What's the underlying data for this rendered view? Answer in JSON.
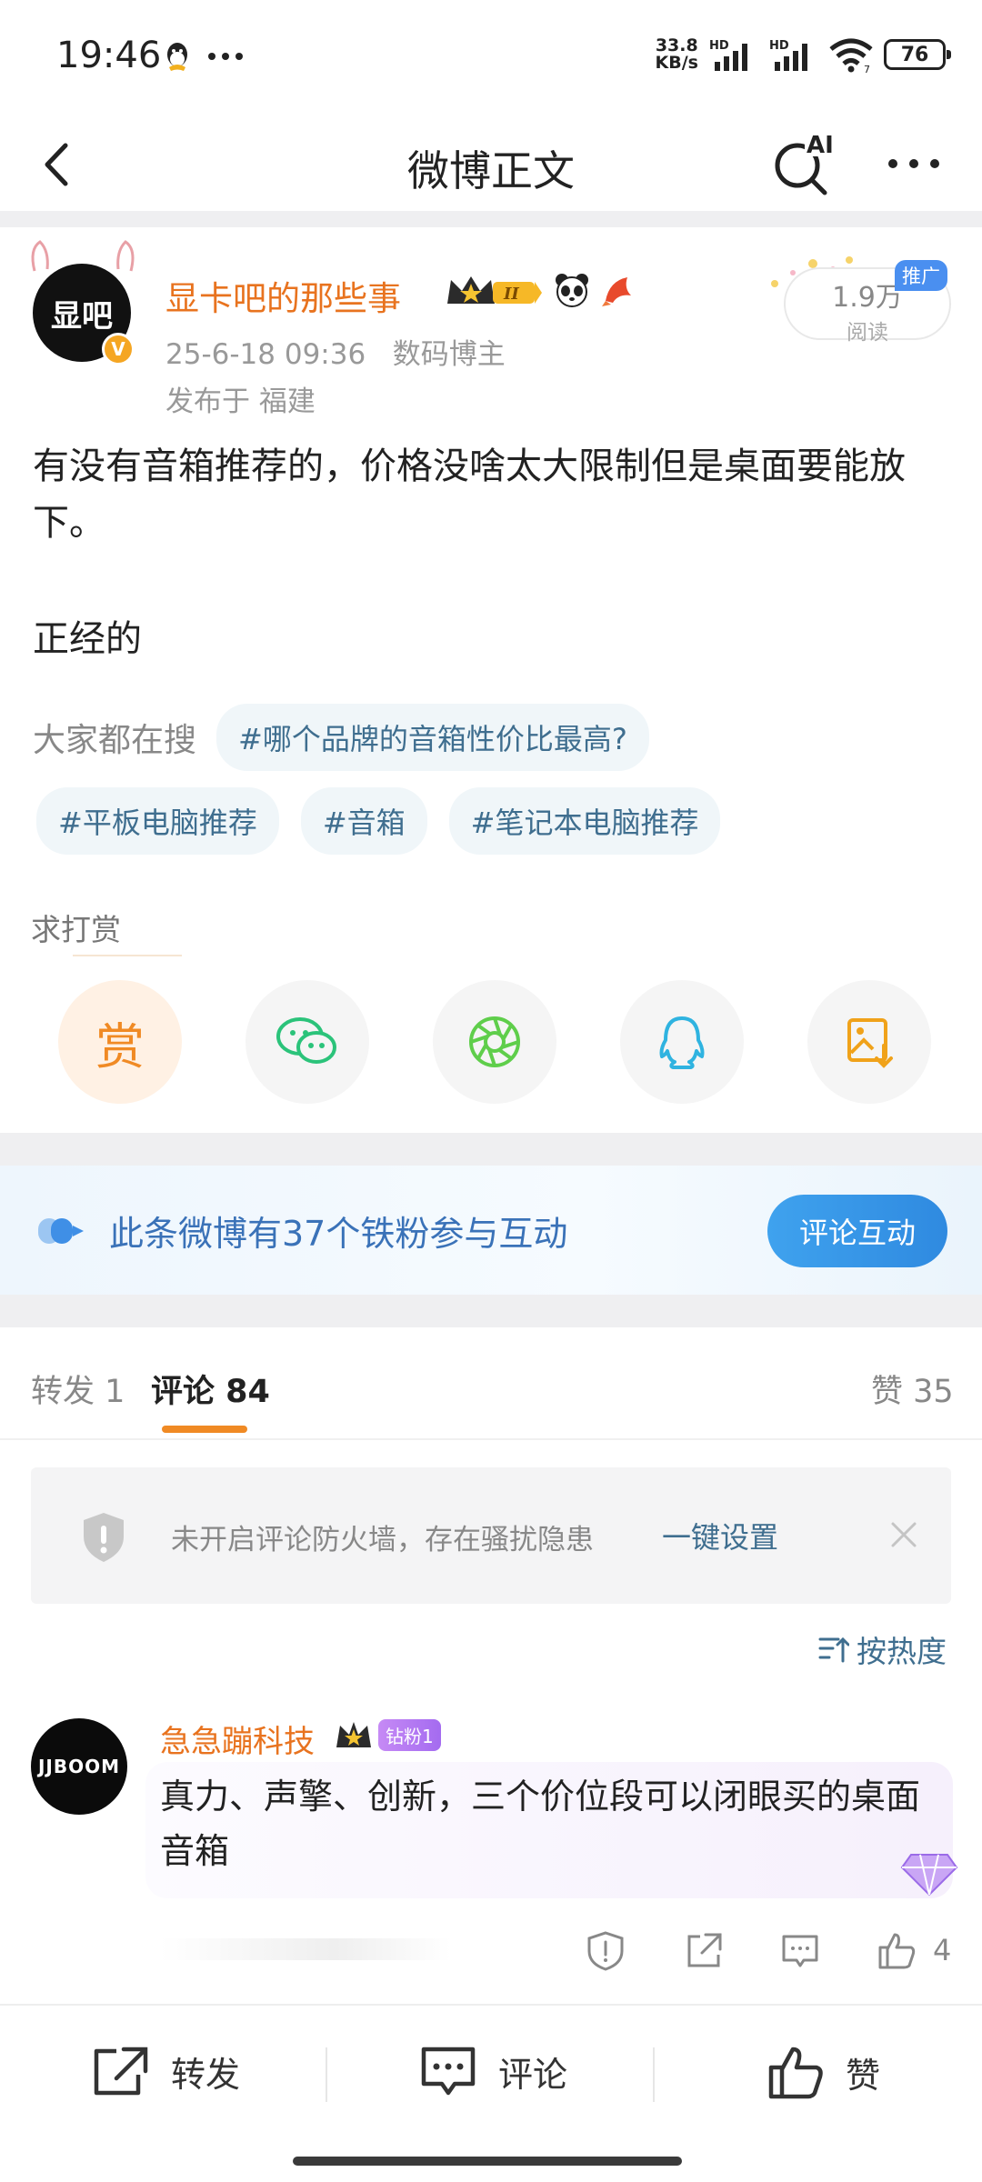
{
  "status_bar": {
    "time": "19:46",
    "net_speed_value": "33.8",
    "net_speed_unit": "KB/s",
    "signal1_label": "HD",
    "signal2_label": "HD",
    "wifi_label": "7",
    "battery": "76"
  },
  "nav": {
    "title": "微博正文",
    "ai_label": "AI"
  },
  "post": {
    "author": "显卡吧的那些事",
    "level_badge": "II",
    "date": "25-6-18 09:36",
    "role": "数码博主",
    "location": "发布于 福建",
    "reads_count": "1.9万",
    "reads_label": "阅读",
    "promo_tag": "推广",
    "verified": "V",
    "avatar_text": "显吧",
    "body_line": "有没有音箱推荐的，价格没啥太大限制但是桌面要能放下。",
    "body_line2": "正经的"
  },
  "search": {
    "label": "大家都在搜",
    "topics": [
      "#哪个品牌的音箱性价比最高?",
      "#平板电脑推荐",
      "#音箱",
      "#笔记本电脑推荐"
    ]
  },
  "tip": {
    "label": "求打赏",
    "reward_glyph": "赏"
  },
  "fans_banner": {
    "text": "此条微博有37个铁粉参与互动",
    "button": "评论互动"
  },
  "tabs": {
    "repost": "转发 1",
    "comments": "评论 84",
    "likes": "赞 35"
  },
  "firewall": {
    "text": "未开启评论防火墙，存在骚扰隐患",
    "link": "一键设置"
  },
  "sort": {
    "label": "按热度"
  },
  "comment": {
    "avatar_text": "JJBOOM",
    "name": "急急蹦科技",
    "fan_badge": "钻粉1",
    "text": "真力、声擎、创新，三个价位段可以闭眼买的桌面音箱",
    "like_count": "4"
  },
  "bottom_bar": {
    "repost": "转发",
    "comment": "评论",
    "like": "赞"
  },
  "colors": {
    "accent_orange": "#e8731f",
    "link_blue": "#3f6e8f",
    "tab_underline": "#f08a24",
    "banner_blue": "#3a72b8"
  }
}
